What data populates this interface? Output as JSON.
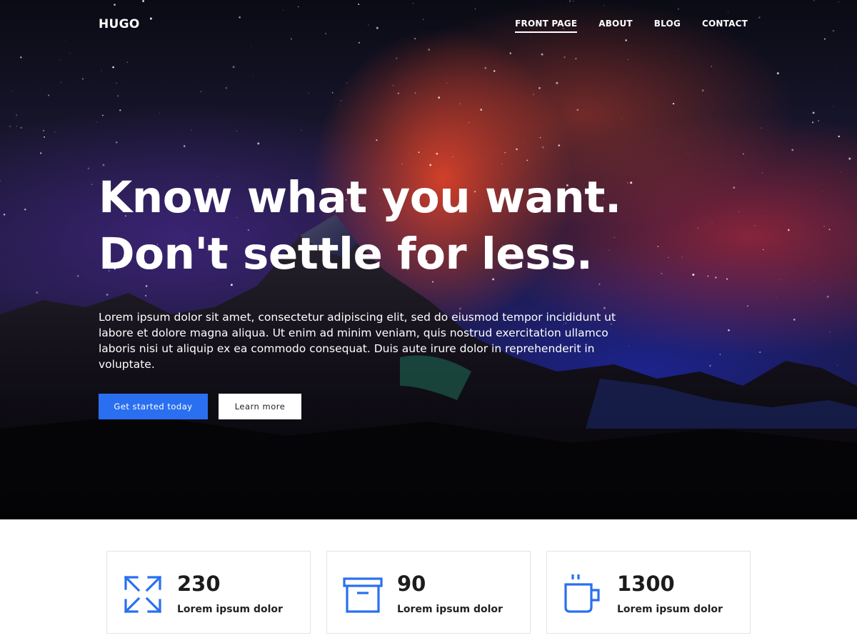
{
  "nav": {
    "logo": "HUGO",
    "items": [
      {
        "label": "FRONT PAGE",
        "active": true
      },
      {
        "label": "ABOUT",
        "active": false
      },
      {
        "label": "BLOG",
        "active": false
      },
      {
        "label": "CONTACT",
        "active": false
      }
    ]
  },
  "hero": {
    "headline_line1": "Know what you want.",
    "headline_line2": "Don't settle for less.",
    "lead": "Lorem ipsum dolor sit amet, consectetur adipiscing elit, sed do eiusmod tempor incididunt ut labore et dolore magna aliqua. Ut enim ad minim veniam, quis nostrud exercitation ullamco laboris nisi ut aliquip ex ea commodo consequat. Duis aute irure dolor in reprehenderit in voluptate.",
    "primary_button": "Get started today",
    "secondary_button": "Learn more"
  },
  "stats": [
    {
      "icon": "expand-arrows-icon",
      "value": "230",
      "label": "Lorem ipsum dolor"
    },
    {
      "icon": "archive-box-icon",
      "value": "90",
      "label": "Lorem ipsum dolor"
    },
    {
      "icon": "coffee-mug-icon",
      "value": "1300",
      "label": "Lorem ipsum dolor"
    }
  ],
  "colors": {
    "accent": "#2a6ff0",
    "hero_dark": "#0a0b14",
    "card_border": "#e3e3e3"
  }
}
